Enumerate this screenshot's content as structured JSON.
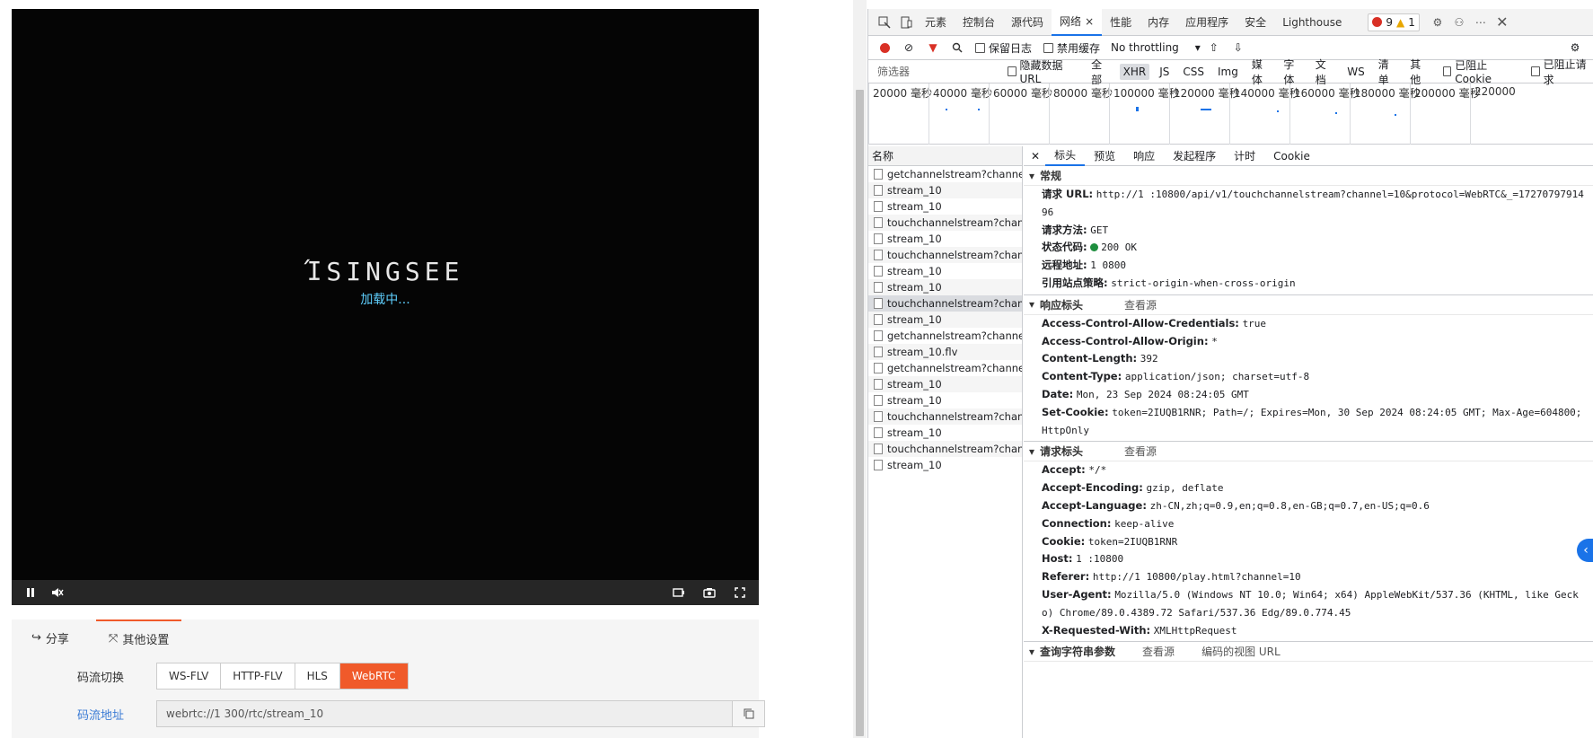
{
  "player": {
    "logo_text": "ΊSINGSEE",
    "loading_text": "加载中...",
    "controls": {
      "pause_icon": "pause-icon",
      "mute_icon": "mute-icon",
      "record_icon": "record-icon",
      "snapshot_icon": "camera-icon",
      "fullscreen_icon": "fullscreen-icon"
    }
  },
  "settings": {
    "tabs": [
      {
        "label": "分享",
        "icon": "share-icon"
      },
      {
        "label": "其他设置",
        "icon": "expand-icon"
      }
    ],
    "stream_switch_label": "码流切换",
    "stream_options": [
      "WS-FLV",
      "HTTP-FLV",
      "HLS",
      "WebRTC"
    ],
    "selected_stream": "WebRTC",
    "stream_addr_label": "码流地址",
    "stream_addr_value": "webrtc://1            300/rtc/stream_10",
    "accent_color": "#f05a2a"
  },
  "devtools": {
    "tabs": [
      "元素",
      "控制台",
      "源代码",
      "网络",
      "性能",
      "内存",
      "应用程序",
      "安全",
      "Lighthouse"
    ],
    "active_tab": "网络",
    "error_count": "9",
    "warning_count": "1",
    "toolbar": {
      "preserve_log": "保留日志",
      "disable_cache": "禁用缓存",
      "throttling": "No throttling"
    },
    "filter": {
      "placeholder": "筛选器",
      "hide_data_urls": "隐藏数据 URL",
      "types": [
        "全部",
        "XHR",
        "JS",
        "CSS",
        "Img",
        "媒体",
        "字体",
        "文档",
        "WS",
        "清单",
        "其他"
      ],
      "active_type": "XHR",
      "blocked_cookies": "已阻止 Cookie",
      "blocked_requests": "已阻止请求"
    },
    "timeline_ticks": [
      "20000 毫秒",
      "40000 毫秒",
      "60000 毫秒",
      "80000 毫秒",
      "100000 毫秒",
      "120000 毫秒",
      "140000 毫秒",
      "160000 毫秒",
      "180000 毫秒",
      "200000 毫秒",
      "220000"
    ],
    "list_header": "名称",
    "requests": [
      "getchannelstream?channel=1...",
      "stream_10",
      "stream_10",
      "touchchannelstream?channel...",
      "stream_10",
      "touchchannelstream?channel...",
      "stream_10",
      "stream_10",
      "touchchannelstream?channel...",
      "stream_10",
      "getchannelstream?channel=1...",
      "stream_10.flv",
      "getchannelstream?channel=1...",
      "stream_10",
      "stream_10",
      "touchchannelstream?channel...",
      "stream_10",
      "touchchannelstream?channel...",
      "stream_10"
    ],
    "selected_request_index": 8,
    "detail_tabs": [
      "标头",
      "预览",
      "响应",
      "发起程序",
      "计时",
      "Cookie"
    ],
    "active_detail_tab": "标头",
    "general": {
      "title": "常规",
      "request_url_k": "请求 URL:",
      "request_url_v": "http://1          :10800/api/v1/touchchannelstream?channel=10&protocol=WebRTC&_=1727079791496",
      "method_k": "请求方法:",
      "method_v": "GET",
      "status_k": "状态代码:",
      "status_v": "200 OK",
      "remote_k": "远程地址:",
      "remote_v": "1            0800",
      "referrer_policy_k": "引用站点策略:",
      "referrer_policy_v": "strict-origin-when-cross-origin"
    },
    "response_headers": {
      "title": "响应标头",
      "view_source": "查看源",
      "items": [
        {
          "k": "Access-Control-Allow-Credentials:",
          "v": "true"
        },
        {
          "k": "Access-Control-Allow-Origin:",
          "v": "*"
        },
        {
          "k": "Content-Length:",
          "v": "392"
        },
        {
          "k": "Content-Type:",
          "v": "application/json; charset=utf-8"
        },
        {
          "k": "Date:",
          "v": "Mon, 23 Sep 2024 08:24:05 GMT"
        },
        {
          "k": "Set-Cookie:",
          "v": "token=2IUQB1RNR; Path=/; Expires=Mon, 30 Sep 2024 08:24:05 GMT; Max-Age=604800; HttpOnly"
        }
      ]
    },
    "request_headers": {
      "title": "请求标头",
      "view_source": "查看源",
      "items": [
        {
          "k": "Accept:",
          "v": "*/*"
        },
        {
          "k": "Accept-Encoding:",
          "v": "gzip, deflate"
        },
        {
          "k": "Accept-Language:",
          "v": "zh-CN,zh;q=0.9,en;q=0.8,en-GB;q=0.7,en-US;q=0.6"
        },
        {
          "k": "Connection:",
          "v": "keep-alive"
        },
        {
          "k": "Cookie:",
          "v": "token=2IUQB1RNR"
        },
        {
          "k": "Host:",
          "v": "1          :10800"
        },
        {
          "k": "Referer:",
          "v": "http://1            10800/play.html?channel=10"
        },
        {
          "k": "User-Agent:",
          "v": "Mozilla/5.0 (Windows NT 10.0; Win64; x64) AppleWebKit/537.36 (KHTML, like Gecko) Chrome/89.0.4389.72 Safari/537.36 Edg/89.0.774.45"
        },
        {
          "k": "X-Requested-With:",
          "v": "XMLHttpRequest"
        }
      ]
    },
    "query_params": {
      "title": "查询字符串参数",
      "view_source": "查看源",
      "view_decoded": "编码的视图 URL"
    }
  }
}
